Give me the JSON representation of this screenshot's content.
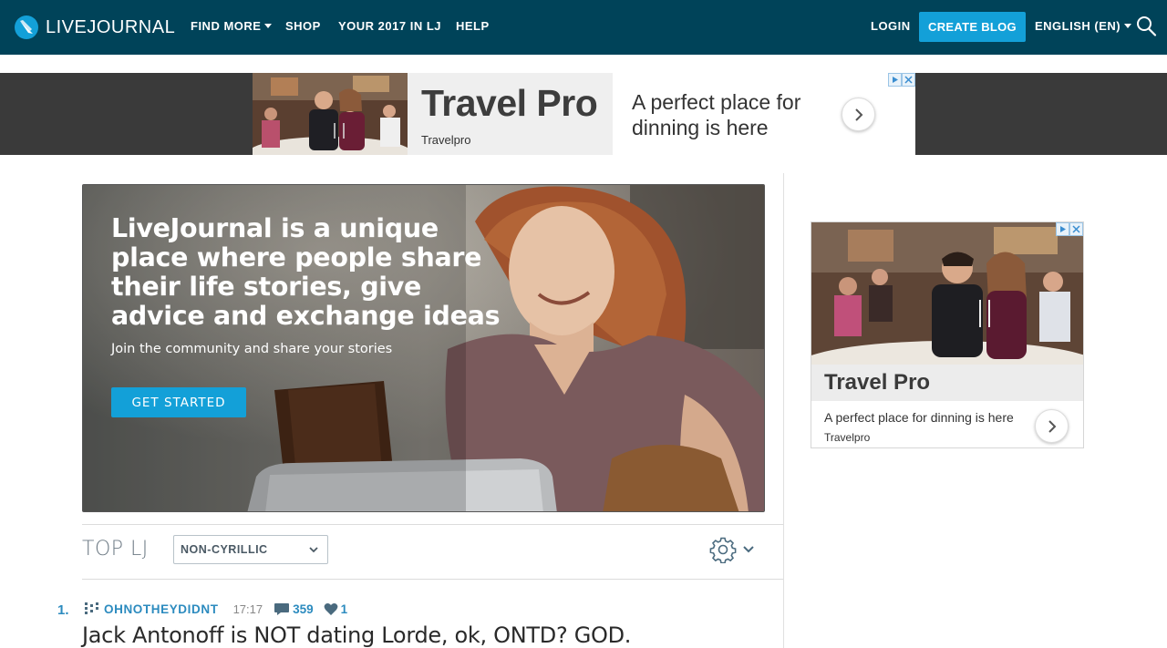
{
  "nav": {
    "logo_text": "LIVEJOURNAL",
    "find_more": "FIND MORE",
    "shop": "SHOP",
    "year": "YOUR 2017 IN LJ",
    "help": "HELP",
    "login": "LOGIN",
    "create_blog": "CREATE BLOG",
    "language": "ENGLISH (EN)",
    "search_icon": "search-icon"
  },
  "top_ad": {
    "title": "Travel Pro",
    "brand": "Travelpro",
    "copy": "A perfect place for dinning is here"
  },
  "hero": {
    "heading": "LiveJournal is a unique place where people share their life stories, give advice and exchange ideas",
    "subheading": "Join the community and share your stories",
    "button": "GET STARTED"
  },
  "top_lj": {
    "title": "TOP LJ",
    "filter_selected": "NON-CYRILLIC"
  },
  "post": {
    "rank": "1.",
    "username": "OHNOTHEYDIDNT",
    "time": "17:17",
    "comments": "359",
    "likes": "1",
    "title": "Jack Antonoff is NOT dating Lorde, ok, ONTD? GOD."
  },
  "side_ad": {
    "title": "Travel Pro",
    "copy": "A perfect place for dinning is here",
    "brand": "Travelpro"
  },
  "colors": {
    "nav_bg": "#004359",
    "accent": "#13a0d8",
    "link": "#2c8bbf"
  }
}
